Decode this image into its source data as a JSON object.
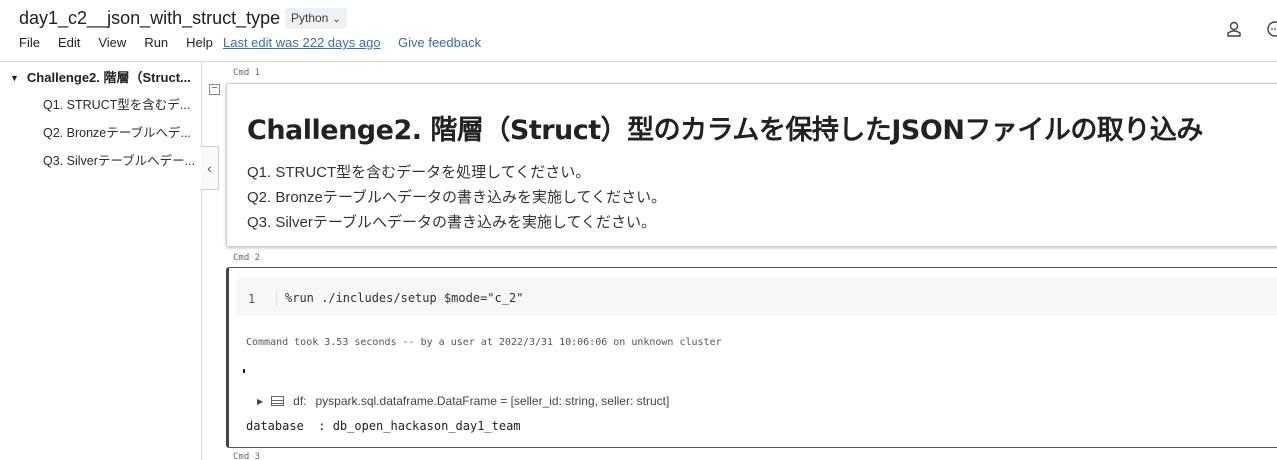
{
  "header": {
    "title": "day1_c2__json_with_struct_type",
    "language": "Python",
    "menu": [
      "File",
      "Edit",
      "View",
      "Run",
      "Help"
    ],
    "last_edit": "Last edit was 222 days ago",
    "feedback": "Give feedback"
  },
  "sidebar": {
    "heading": "Challenge2. 階層（Struct...",
    "items": [
      {
        "label": "Q1. STRUCT型を含むデ..."
      },
      {
        "label": "Q2. Bronzeテーブルへデ..."
      },
      {
        "label": "Q3. Silverテーブルへデー..."
      }
    ]
  },
  "cells": [
    {
      "cmd": "Cmd 1",
      "title": "Challenge2. 階層（Struct）型のカラムを保持したJSONファイルの取り込み",
      "lines": [
        "Q1. STRUCT型を含むデータを処理してください。",
        "Q2. Bronzeテーブルへデータの書き込みを実施してください。",
        "Q3. Silverテーブルへデータの書き込みを実施してください。"
      ]
    },
    {
      "cmd": "Cmd 2",
      "line_number": "1",
      "code": "%run ./includes/setup $mode=\"c_2\"",
      "took": "Command took 3.53 seconds -- by a user at 2022/3/31 10:06:06 on unknown cluster",
      "df_name": "df:",
      "df_type": "pyspark.sql.dataframe.DataFrame = [seller_id: string, seller: struct]",
      "database_line": "database  : db_open_hackason_day1_team"
    },
    {
      "cmd": "Cmd 3"
    }
  ]
}
